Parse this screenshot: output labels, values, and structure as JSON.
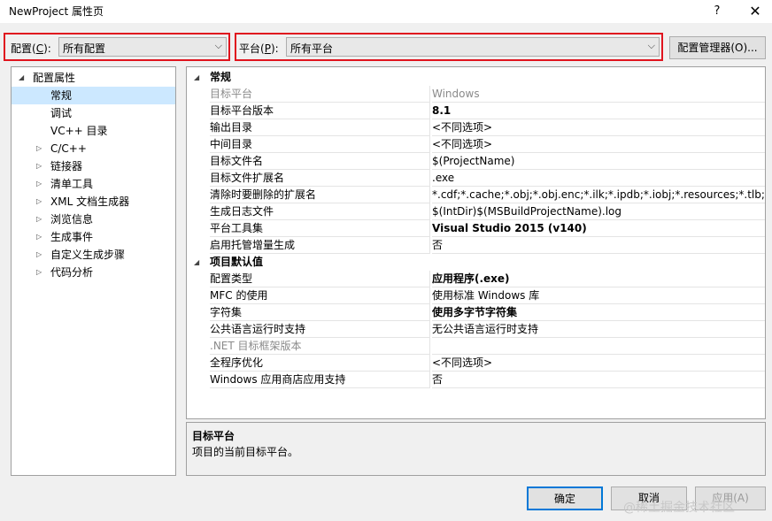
{
  "window": {
    "title": "NewProject 属性页",
    "help": "?",
    "close": "✕"
  },
  "toolbar": {
    "config_label": "配置(C):",
    "config_label_main": "配置(",
    "config_accel": "C",
    "config_label_end": "):",
    "config_value": "所有配置",
    "platform_label_main": "平台(",
    "platform_accel": "P",
    "platform_label_end": "):",
    "platform_value": "所有平台",
    "config_manager_label": "配置管理器(O)..."
  },
  "tree": {
    "items": [
      {
        "label": "配置属性",
        "expanded": true
      },
      {
        "label": "常规",
        "selected": true
      },
      {
        "label": "调试"
      },
      {
        "label": "VC++ 目录"
      },
      {
        "label": "C/C++"
      },
      {
        "label": "链接器"
      },
      {
        "label": "清单工具"
      },
      {
        "label": "XML 文档生成器"
      },
      {
        "label": "浏览信息"
      },
      {
        "label": "生成事件"
      },
      {
        "label": "自定义生成步骤"
      },
      {
        "label": "代码分析"
      }
    ]
  },
  "grid": {
    "cat1": "常规",
    "cat2": "项目默认值",
    "rows": [
      {
        "name": "目标平台",
        "value": "Windows"
      },
      {
        "name": "目标平台版本",
        "value": "8.1"
      },
      {
        "name": "输出目录",
        "value": "<不同选项>"
      },
      {
        "name": "中间目录",
        "value": "<不同选项>"
      },
      {
        "name": "目标文件名",
        "value": "$(ProjectName)"
      },
      {
        "name": "目标文件扩展名",
        "value": ".exe"
      },
      {
        "name": "清除时要删除的扩展名",
        "value": "*.cdf;*.cache;*.obj;*.obj.enc;*.ilk;*.ipdb;*.iobj;*.resources;*.tlb;*.tli;*.t"
      },
      {
        "name": "生成日志文件",
        "value": "$(IntDir)$(MSBuildProjectName).log"
      },
      {
        "name": "平台工具集",
        "value": "Visual Studio 2015 (v140)"
      },
      {
        "name": "启用托管增量生成",
        "value": "否"
      },
      {
        "name": "配置类型",
        "value": "应用程序(.exe)"
      },
      {
        "name": "MFC 的使用",
        "value": "使用标准 Windows 库"
      },
      {
        "name": "字符集",
        "value": "使用多字节字符集"
      },
      {
        "name": "公共语言运行时支持",
        "value": "无公共语言运行时支持"
      },
      {
        "name": ".NET 目标框架版本",
        "value": ""
      },
      {
        "name": "全程序优化",
        "value": "<不同选项>"
      },
      {
        "name": "Windows 应用商店应用支持",
        "value": "否"
      }
    ]
  },
  "description": {
    "title": "目标平台",
    "text": "项目的当前目标平台。"
  },
  "buttons": {
    "ok": "确定",
    "cancel": "取消",
    "apply": "应用(A)"
  },
  "watermark": "@稀土掘金技术社区",
  "colors": {
    "highlight_box": "#e0141e",
    "selection": "#cce8ff",
    "ok_border": "#0078d7"
  }
}
